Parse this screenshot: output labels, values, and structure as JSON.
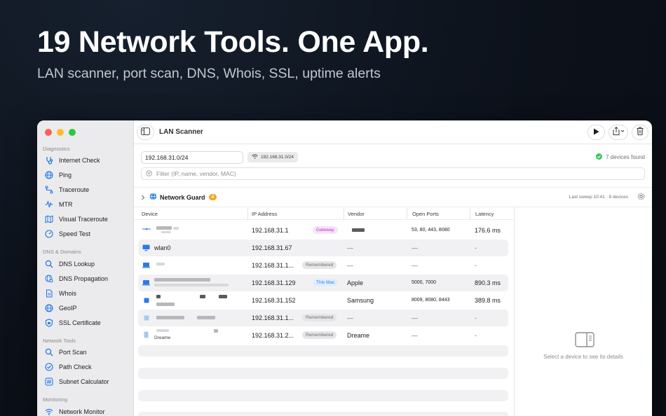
{
  "hero": {
    "title": "19 Network Tools. One App.",
    "subtitle": "LAN scanner, port scan, DNS, Whois, SSL, uptime alerts"
  },
  "window": {
    "title": "LAN Scanner"
  },
  "sidebar": {
    "sections": [
      {
        "title": "Diagnostics",
        "items": [
          "Internet Check",
          "Ping",
          "Traceroute",
          "MTR",
          "Visual Traceroute",
          "Speed Test"
        ]
      },
      {
        "title": "DNS & Domains",
        "items": [
          "DNS Lookup",
          "DNS Propagation",
          "Whois",
          "GeoIP",
          "SSL Certificate"
        ]
      },
      {
        "title": "Network Tools",
        "items": [
          "Port Scan",
          "Path Check",
          "Subnet Calculator"
        ]
      },
      {
        "title": "Monitoring",
        "items": [
          "Network Monitor"
        ]
      }
    ],
    "icons": {
      "Internet Check": "stethoscope-icon",
      "Ping": "globe-icon",
      "Traceroute": "route-icon",
      "MTR": "waveform-icon",
      "Visual Traceroute": "map-icon",
      "Speed Test": "gauge-icon",
      "DNS Lookup": "search-icon",
      "DNS Propagation": "globe-search-icon",
      "Whois": "document-icon",
      "GeoIP": "globe-icon",
      "SSL Certificate": "shield-icon",
      "Port Scan": "search-icon",
      "Path Check": "checkmark-circle-icon",
      "Subnet Calculator": "hash-icon",
      "Network Monitor": "wifi-icon"
    }
  },
  "scan": {
    "subnet": "192.168.31.0/24",
    "interface": "192.168.31.0/24",
    "found": "7 devices found",
    "filter_placeholder": "Filter (IP, name, vendor, MAC)"
  },
  "guard": {
    "label": "Network Guard",
    "badge": "4",
    "sweep": "Last sweep 10:41 · 8 devices"
  },
  "table": {
    "headers": [
      "Device",
      "IP Address",
      "Vendor",
      "Open Ports",
      "Latency"
    ],
    "rows": [
      {
        "device": "",
        "ip": "192.168.31.1",
        "tag": "Gateway",
        "vendor": "",
        "ports": "53, 80, 443, 8080",
        "latency": "176.6 ms"
      },
      {
        "device": "wlan0",
        "ip": "192.168.31.67",
        "tag": "",
        "vendor": "—",
        "ports": "—",
        "latency": "-"
      },
      {
        "device": "",
        "ip": "192.168.31.1...",
        "tag": "Remembered",
        "vendor": "—",
        "ports": "—",
        "latency": "-"
      },
      {
        "device": "",
        "ip": "192.168.31.129",
        "tag": "This Mac",
        "vendor": "Apple",
        "ports": "5000, 7000",
        "latency": "890.3 ms"
      },
      {
        "device": "",
        "ip": "192.168.31.152",
        "tag": "",
        "vendor": "Samsung",
        "ports": "8009, 8080, 8443",
        "latency": "389.8 ms"
      },
      {
        "device": "",
        "ip": "192.168.31.1...",
        "tag": "Remembered",
        "vendor": "—",
        "ports": "—",
        "latency": "-"
      },
      {
        "device": "Dreame",
        "ip": "192.168.31.2...",
        "tag": "Remembered",
        "vendor": "Dreame",
        "ports": "—",
        "latency": "-"
      }
    ]
  },
  "detail": {
    "empty_text": "Select a device to see its details"
  },
  "colors": {
    "accent": "#2c7be5",
    "badge": "#f5a623",
    "success": "#34c759"
  }
}
